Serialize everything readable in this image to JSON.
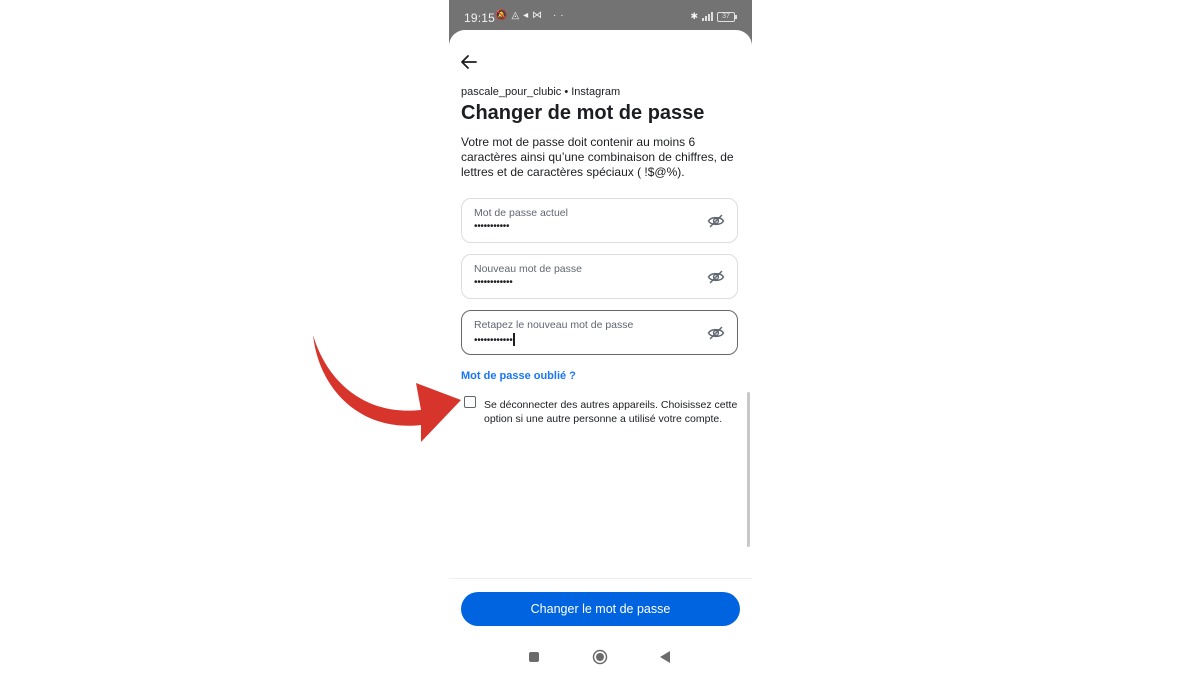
{
  "statusbar": {
    "time": "19:15",
    "left_icons": "🔕◬◂⋈ ··",
    "battery": "37"
  },
  "header": {
    "account": "pascale_pour_clubic • Instagram",
    "title": "Changer de mot de passe",
    "description": "Votre mot de passe doit contenir au moins 6 caractères ainsi qu’une combinaison de chiffres, de lettres et de caractères spéciaux ( !$@%)."
  },
  "fields": [
    {
      "label": "Mot de passe actuel",
      "value": "•••••••••••"
    },
    {
      "label": "Nouveau mot de passe",
      "value": "••••••••••••"
    },
    {
      "label": "Retapez le nouveau mot de passe",
      "value": "••••••••••••"
    }
  ],
  "forgot_link": "Mot de passe oublié ?",
  "logout_option": {
    "label": "Se déconnecter des autres appareils. Choisissez cette option si une autre personne a utilisé votre compte.",
    "checked": false
  },
  "submit_label": "Changer le mot de passe",
  "colors": {
    "accent": "#0064e0",
    "link": "#1877f2",
    "annotation_arrow": "#d7342c",
    "statusbar": "#737373"
  },
  "icons": [
    "back-arrow-icon",
    "eye-off-icon",
    "checkbox-icon",
    "nav-recents-icon",
    "nav-home-icon",
    "nav-back-icon",
    "red-arrow-annotation"
  ]
}
